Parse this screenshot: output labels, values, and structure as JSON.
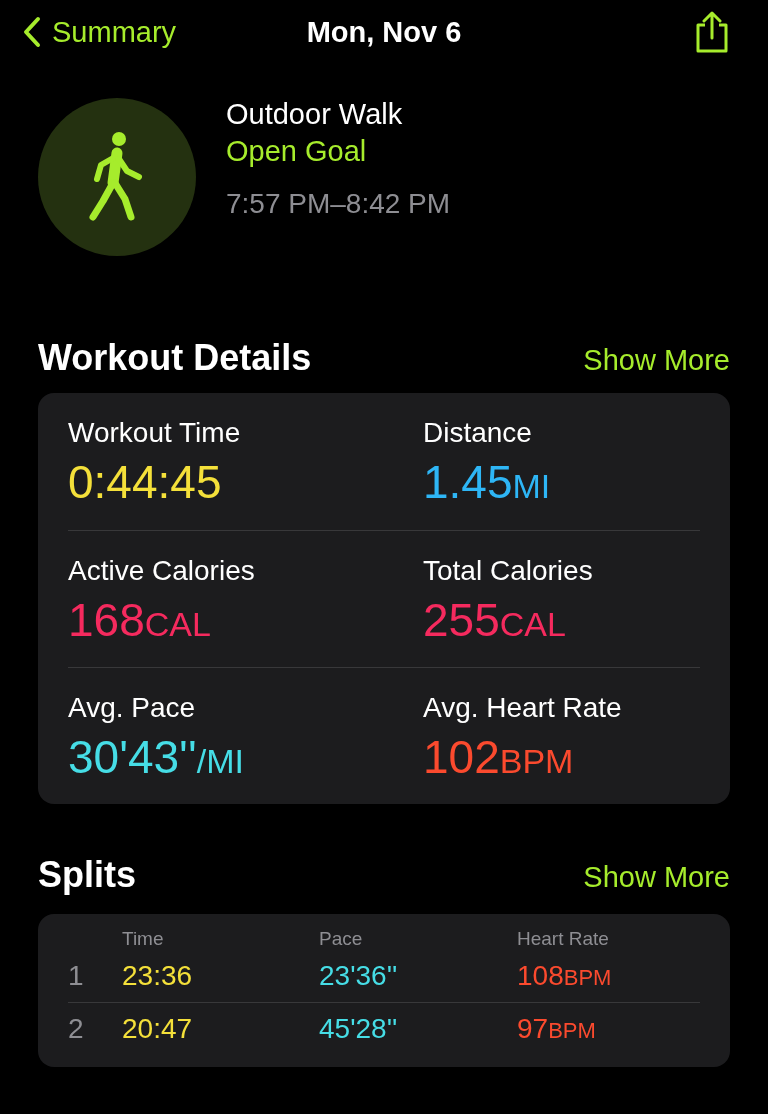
{
  "nav": {
    "back_label": "Summary",
    "title": "Mon, Nov 6"
  },
  "workout": {
    "name": "Outdoor Walk",
    "goal": "Open Goal",
    "time_range": "7:57 PM–8:42 PM"
  },
  "workout_details": {
    "heading": "Workout Details",
    "show_more": "Show More",
    "metrics": [
      {
        "label": "Workout Time",
        "value": "0:44:45",
        "color": "#f4e03a"
      },
      {
        "label": "Distance",
        "value": "1.45",
        "unit": "MI",
        "color": "#2eb6f6"
      },
      {
        "label": "Active Calories",
        "value": "168",
        "unit": "CAL",
        "color": "#f52a5e"
      },
      {
        "label": "Total Calories",
        "value": "255",
        "unit": "CAL",
        "color": "#f52a5e"
      },
      {
        "label": "Avg. Pace",
        "value": "30'43''",
        "unit": "/MI",
        "color": "#46dde6"
      },
      {
        "label": "Avg. Heart Rate",
        "value": "102",
        "unit": "BPM",
        "color": "#fb4a2e"
      }
    ]
  },
  "splits": {
    "heading": "Splits",
    "show_more": "Show More",
    "columns": [
      {
        "label": "Time",
        "color": "#f4e03a"
      },
      {
        "label": "Pace",
        "color": "#46dde6"
      },
      {
        "label": "Heart Rate",
        "color": "#fb4a2e"
      }
    ],
    "rows": [
      {
        "index": "1",
        "time": "23:36",
        "pace": "23'36''",
        "heart_rate": "108",
        "heart_rate_unit": "BPM"
      },
      {
        "index": "2",
        "time": "20:47",
        "pace": "45'28''",
        "heart_rate": "97",
        "heart_rate_unit": "BPM"
      }
    ]
  }
}
